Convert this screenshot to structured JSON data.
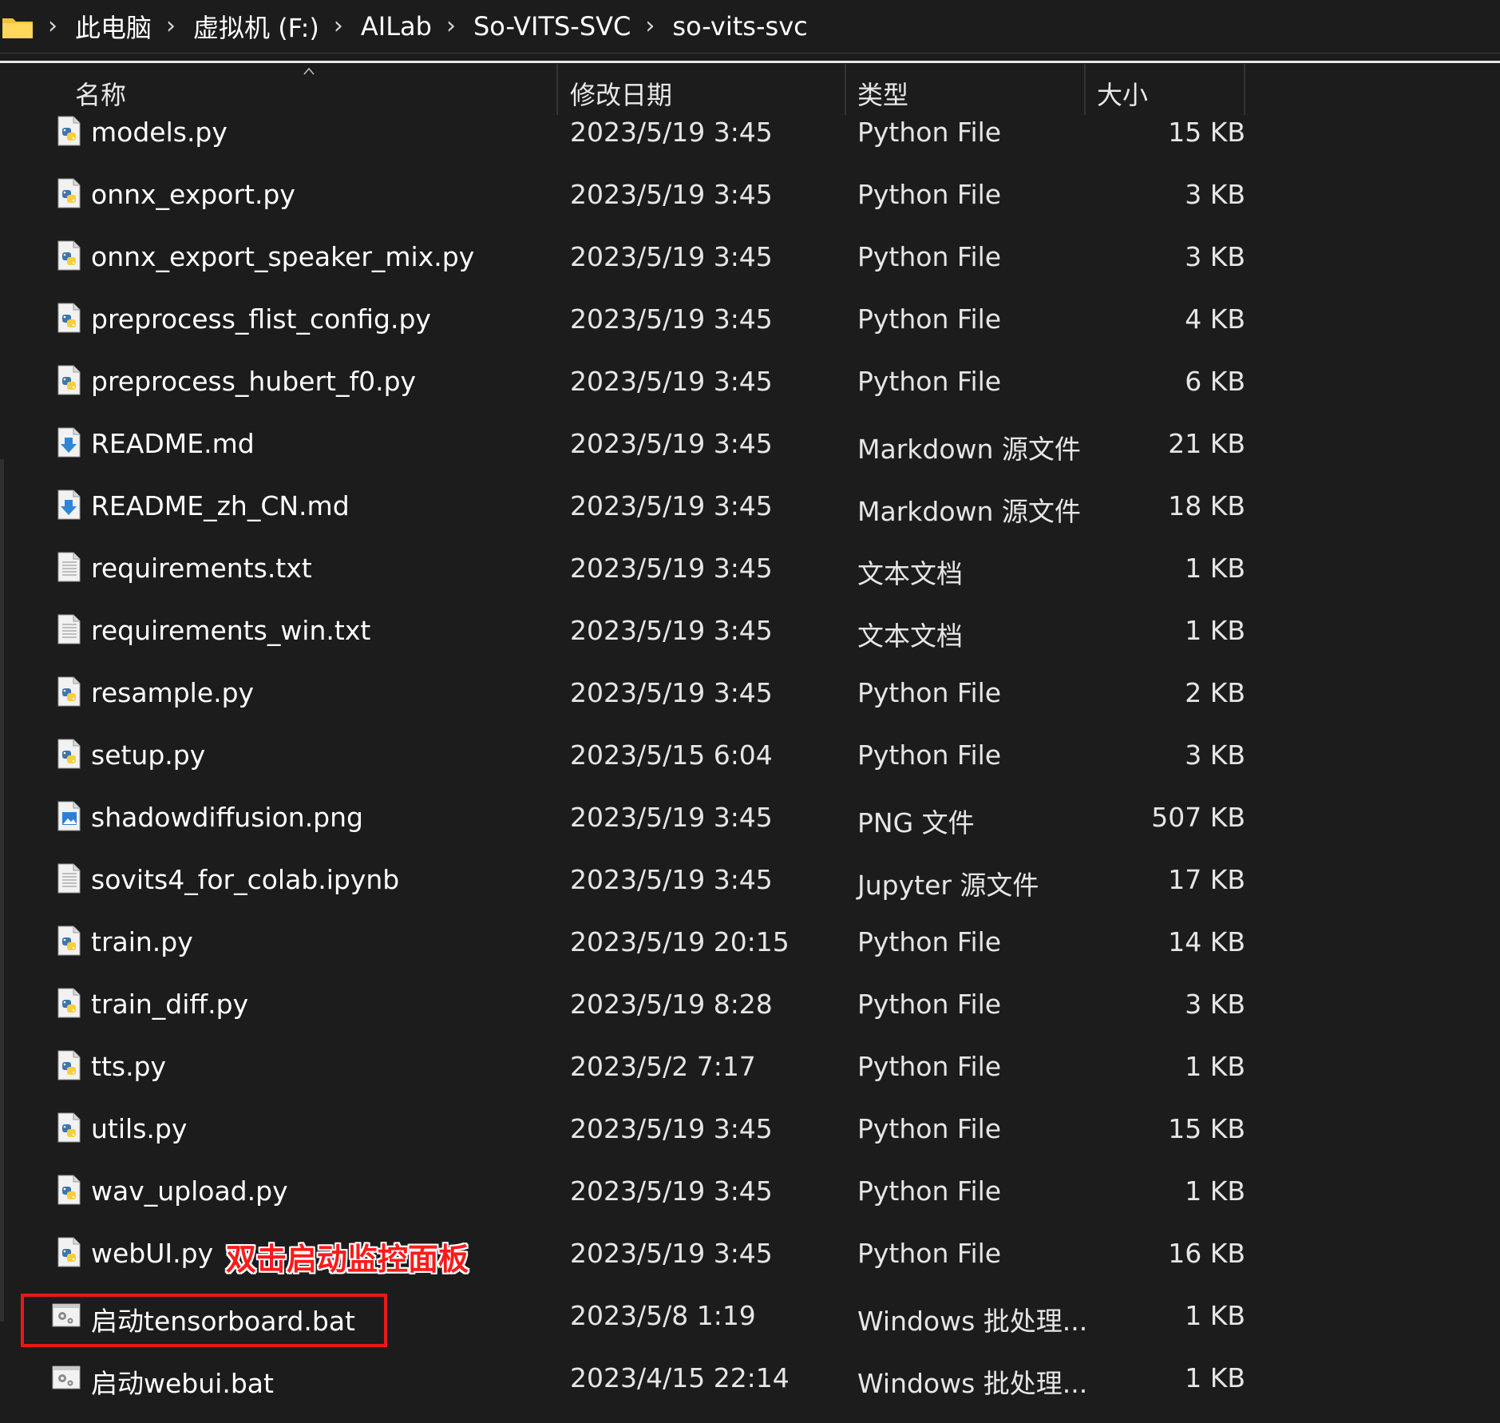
{
  "breadcrumb": [
    "此电脑",
    "虚拟机 (F:)",
    "AILab",
    "So-VITS-SVC",
    "so-vits-svc"
  ],
  "columns": {
    "name": "名称",
    "date": "修改日期",
    "type": "类型",
    "size": "大小"
  },
  "files": [
    {
      "name": "models.py",
      "date": "2023/5/19 3:45",
      "type": "Python File",
      "size": "15 KB",
      "icon": "python-file-icon"
    },
    {
      "name": "onnx_export.py",
      "date": "2023/5/19 3:45",
      "type": "Python File",
      "size": "3 KB",
      "icon": "python-file-icon"
    },
    {
      "name": "onnx_export_speaker_mix.py",
      "date": "2023/5/19 3:45",
      "type": "Python File",
      "size": "3 KB",
      "icon": "python-file-icon"
    },
    {
      "name": "preprocess_flist_config.py",
      "date": "2023/5/19 3:45",
      "type": "Python File",
      "size": "4 KB",
      "icon": "python-file-icon"
    },
    {
      "name": "preprocess_hubert_f0.py",
      "date": "2023/5/19 3:45",
      "type": "Python File",
      "size": "6 KB",
      "icon": "python-file-icon"
    },
    {
      "name": "README.md",
      "date": "2023/5/19 3:45",
      "type": "Markdown 源文件",
      "size": "21 KB",
      "icon": "markdown-file-icon"
    },
    {
      "name": "README_zh_CN.md",
      "date": "2023/5/19 3:45",
      "type": "Markdown 源文件",
      "size": "18 KB",
      "icon": "markdown-file-icon"
    },
    {
      "name": "requirements.txt",
      "date": "2023/5/19 3:45",
      "type": "文本文档",
      "size": "1 KB",
      "icon": "text-file-icon"
    },
    {
      "name": "requirements_win.txt",
      "date": "2023/5/19 3:45",
      "type": "文本文档",
      "size": "1 KB",
      "icon": "text-file-icon"
    },
    {
      "name": "resample.py",
      "date": "2023/5/19 3:45",
      "type": "Python File",
      "size": "2 KB",
      "icon": "python-file-icon"
    },
    {
      "name": "setup.py",
      "date": "2023/5/15 6:04",
      "type": "Python File",
      "size": "3 KB",
      "icon": "python-file-icon"
    },
    {
      "name": "shadowdiffusion.png",
      "date": "2023/5/19 3:45",
      "type": "PNG 文件",
      "size": "507 KB",
      "icon": "image-file-icon"
    },
    {
      "name": "sovits4_for_colab.ipynb",
      "date": "2023/5/19 3:45",
      "type": "Jupyter 源文件",
      "size": "17 KB",
      "icon": "notebook-file-icon"
    },
    {
      "name": "train.py",
      "date": "2023/5/19 20:15",
      "type": "Python File",
      "size": "14 KB",
      "icon": "python-file-icon"
    },
    {
      "name": "train_diff.py",
      "date": "2023/5/19 8:28",
      "type": "Python File",
      "size": "3 KB",
      "icon": "python-file-icon"
    },
    {
      "name": "tts.py",
      "date": "2023/5/2 7:17",
      "type": "Python File",
      "size": "1 KB",
      "icon": "python-file-icon"
    },
    {
      "name": "utils.py",
      "date": "2023/5/19 3:45",
      "type": "Python File",
      "size": "15 KB",
      "icon": "python-file-icon"
    },
    {
      "name": "wav_upload.py",
      "date": "2023/5/19 3:45",
      "type": "Python File",
      "size": "1 KB",
      "icon": "python-file-icon"
    },
    {
      "name": "webUI.py",
      "date": "2023/5/19 3:45",
      "type": "Python File",
      "size": "16 KB",
      "icon": "python-file-icon"
    },
    {
      "name": "启动tensorboard.bat",
      "date": "2023/5/8 1:19",
      "type": "Windows 批处理...",
      "size": "1 KB",
      "icon": "batch-file-icon"
    },
    {
      "name": "启动webui.bat",
      "date": "2023/4/15 22:14",
      "type": "Windows 批处理...",
      "size": "1 KB",
      "icon": "batch-file-icon"
    }
  ],
  "annotation": "双击启动监控面板",
  "colors": {
    "background": "#1c1c1c",
    "annotation": "#ff1a1a",
    "highlight_border": "#e81818"
  }
}
